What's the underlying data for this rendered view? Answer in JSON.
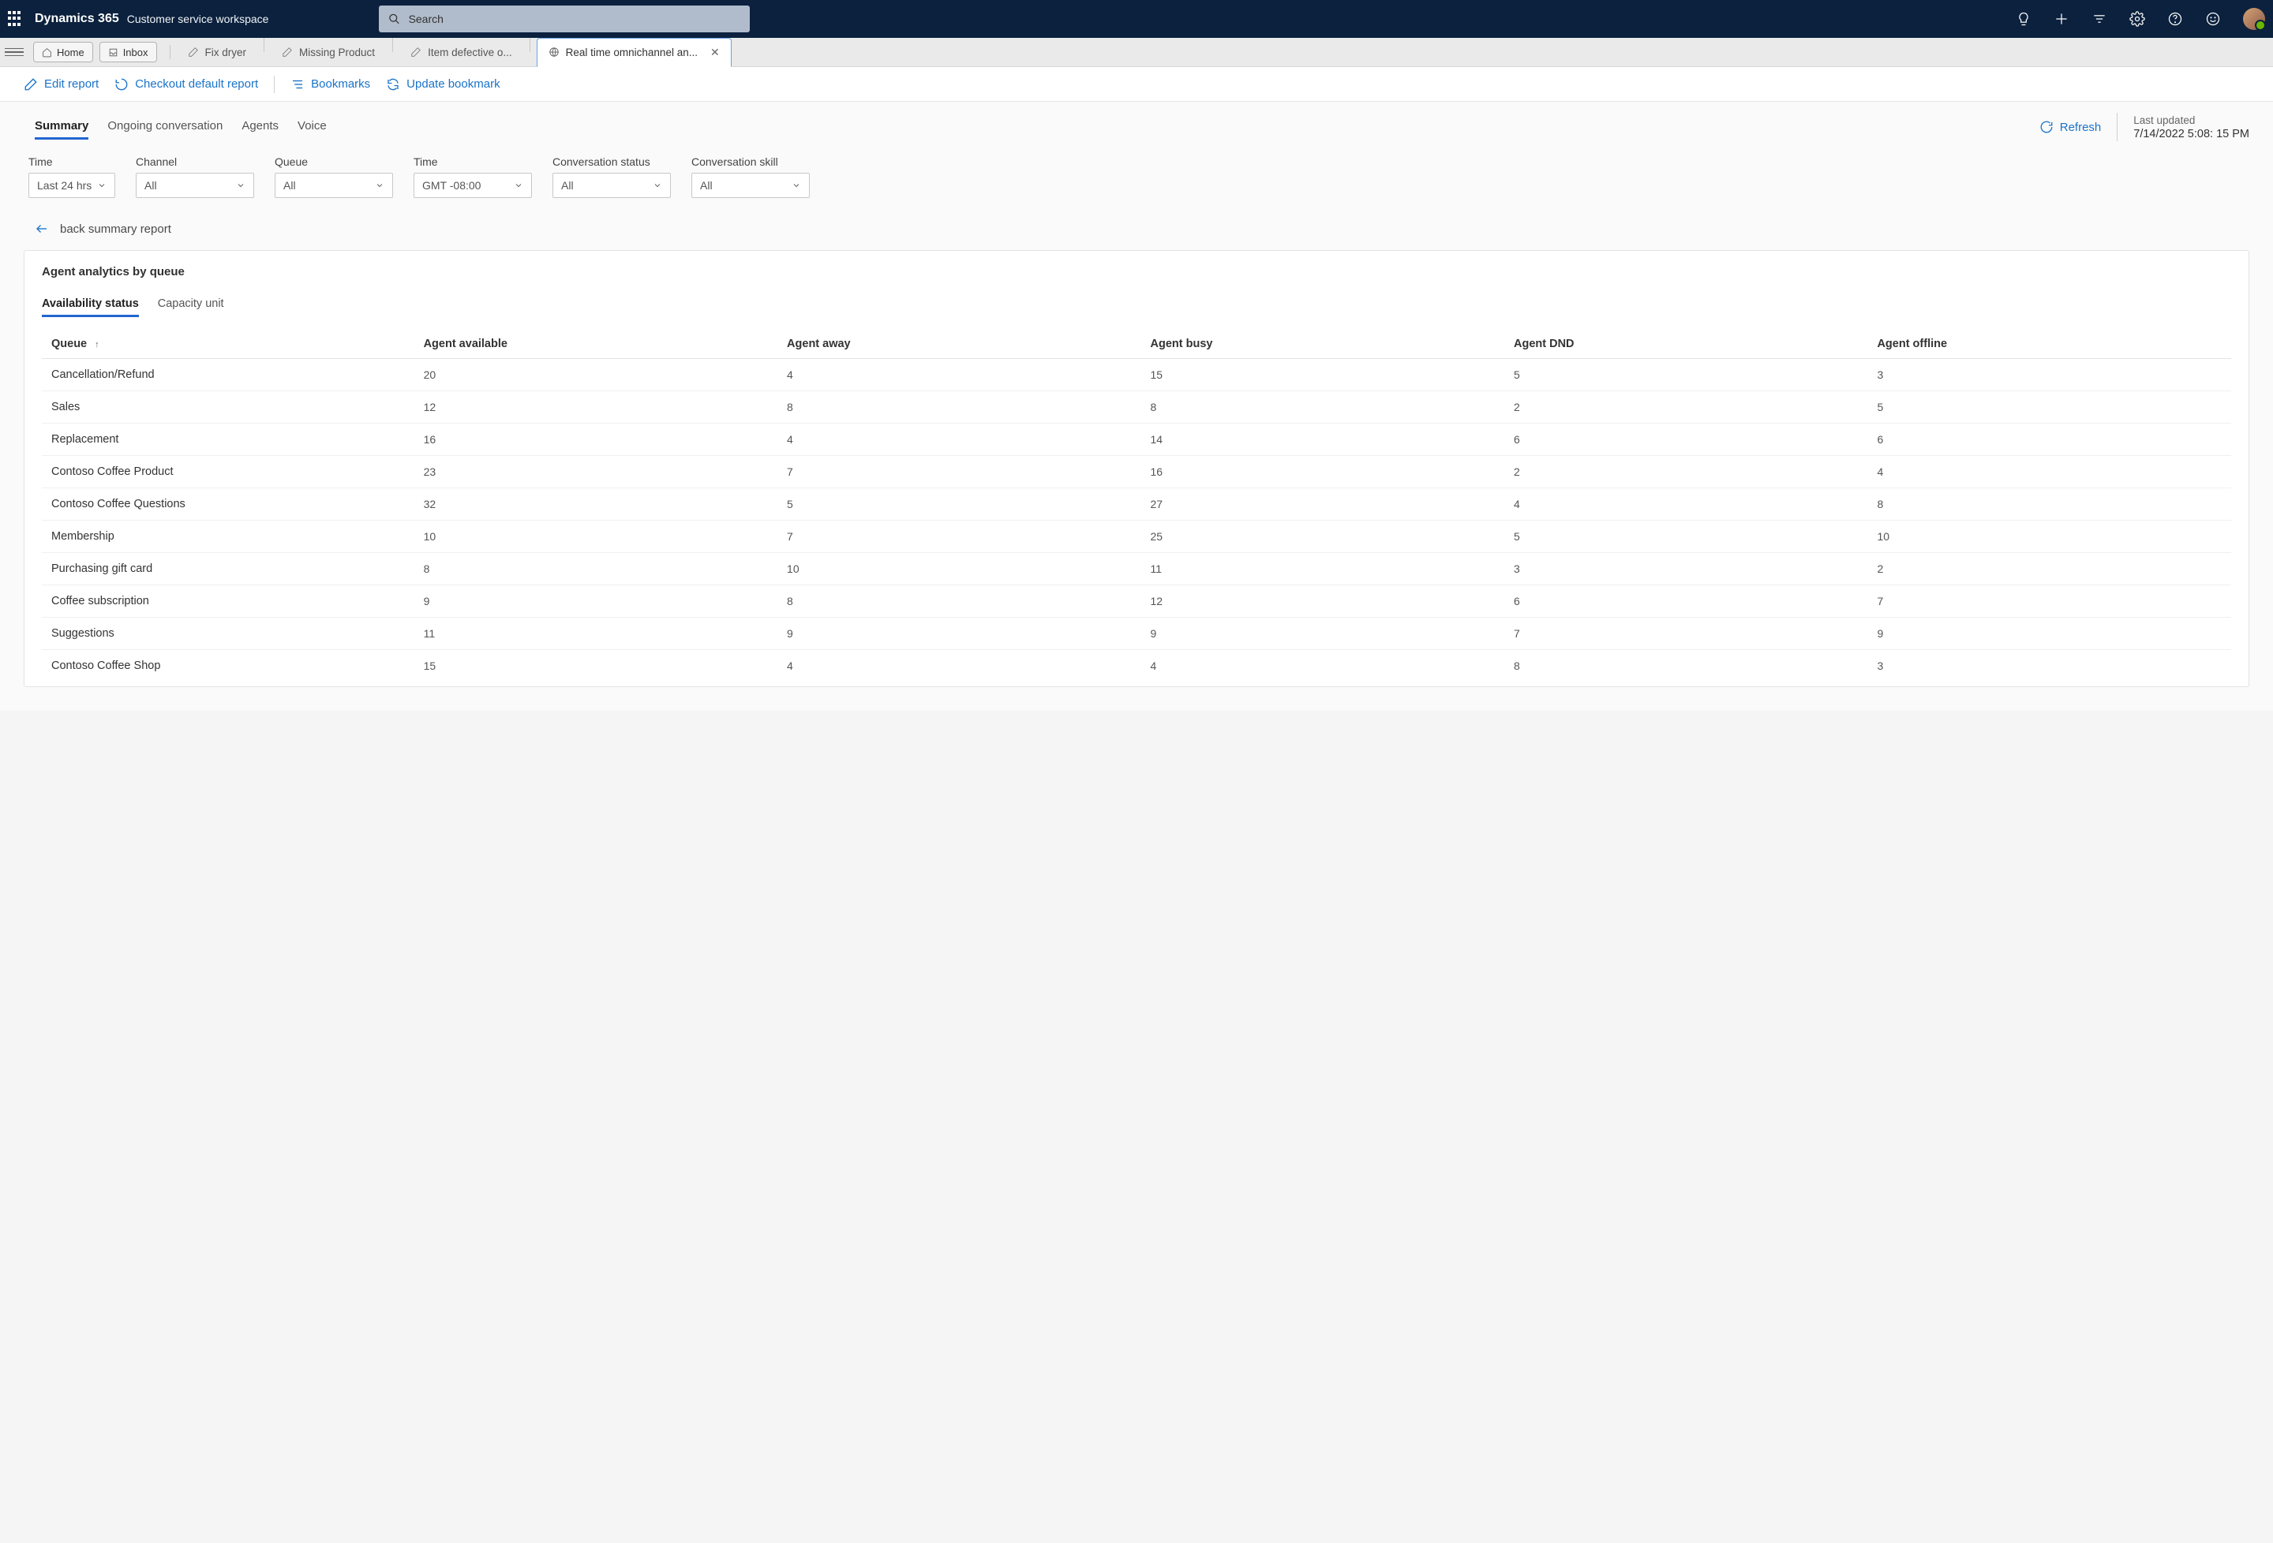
{
  "header": {
    "brand": "Dynamics 365",
    "subtitle": "Customer service workspace",
    "search_placeholder": "Search"
  },
  "tabs": {
    "home": "Home",
    "inbox": "Inbox",
    "items": [
      {
        "label": "Fix dryer"
      },
      {
        "label": "Missing Product"
      },
      {
        "label": "Item defective o..."
      },
      {
        "label": "Real time omnichannel an...",
        "active": true
      }
    ]
  },
  "actions": {
    "edit_report": "Edit report",
    "checkout_default": "Checkout default report",
    "bookmarks": "Bookmarks",
    "update_bookmark": "Update bookmark"
  },
  "report_tabs": {
    "summary": "Summary",
    "ongoing": "Ongoing conversation",
    "agents": "Agents",
    "voice": "Voice"
  },
  "refresh": "Refresh",
  "last_updated": {
    "label": "Last updated",
    "value": "7/14/2022 5:08: 15 PM"
  },
  "filters": [
    {
      "label": "Time",
      "value": "Last 24 hrs",
      "narrow": true
    },
    {
      "label": "Channel",
      "value": "All"
    },
    {
      "label": "Queue",
      "value": "All"
    },
    {
      "label": "Time",
      "value": "GMT -08:00"
    },
    {
      "label": "Conversation status",
      "value": "All"
    },
    {
      "label": "Conversation skill",
      "value": "All"
    }
  ],
  "back_link": "back summary report",
  "card": {
    "title": "Agent analytics by queue",
    "tabs": {
      "availability": "Availability status",
      "capacity": "Capacity unit"
    },
    "columns": [
      "Queue",
      "Agent available",
      "Agent away",
      "Agent busy",
      "Agent DND",
      "Agent offline"
    ],
    "rows": [
      {
        "queue": "Cancellation/Refund",
        "available": "20",
        "away": "4",
        "busy": "15",
        "dnd": "5",
        "offline": "3"
      },
      {
        "queue": "Sales",
        "available": "12",
        "away": "8",
        "busy": "8",
        "dnd": "2",
        "offline": "5"
      },
      {
        "queue": "Replacement",
        "available": "16",
        "away": "4",
        "busy": "14",
        "dnd": "6",
        "offline": "6"
      },
      {
        "queue": "Contoso Coffee Product",
        "available": "23",
        "away": "7",
        "busy": "16",
        "dnd": "2",
        "offline": "4"
      },
      {
        "queue": "Contoso Coffee Questions",
        "available": "32",
        "away": "5",
        "busy": "27",
        "dnd": "4",
        "offline": "8"
      },
      {
        "queue": "Membership",
        "available": "10",
        "away": "7",
        "busy": "25",
        "dnd": "5",
        "offline": "10"
      },
      {
        "queue": "Purchasing gift card",
        "available": "8",
        "away": "10",
        "busy": "11",
        "dnd": "3",
        "offline": "2"
      },
      {
        "queue": "Coffee subscription",
        "available": "9",
        "away": "8",
        "busy": "12",
        "dnd": "6",
        "offline": "7"
      },
      {
        "queue": "Suggestions",
        "available": "11",
        "away": "9",
        "busy": "9",
        "dnd": "7",
        "offline": "9"
      },
      {
        "queue": "Contoso Coffee Shop",
        "available": "15",
        "away": "4",
        "busy": "4",
        "dnd": "8",
        "offline": "3"
      }
    ]
  }
}
